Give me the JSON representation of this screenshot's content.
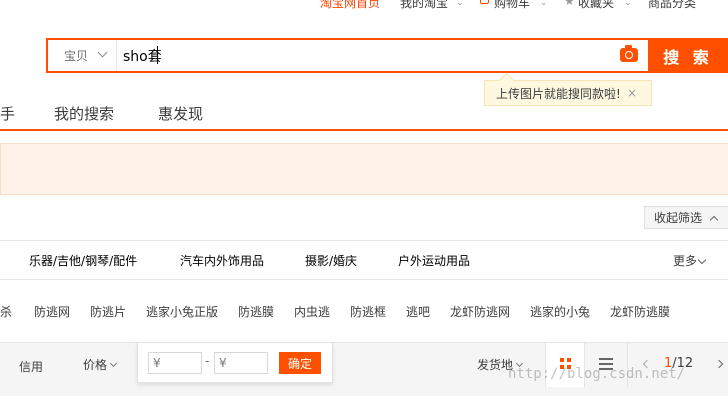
{
  "topbar": {
    "items": [
      "淘宝网首页",
      "我的淘宝",
      "购物车",
      "收藏夹",
      "商品分类"
    ]
  },
  "search": {
    "scope": "宝贝",
    "query": "sho套",
    "button": "搜 索",
    "tooltip": "上传图片就能搜同款啦!",
    "tooltip_close": "×"
  },
  "nav": {
    "tabs": [
      "手",
      "我的搜索",
      "惠发现"
    ]
  },
  "filters": {
    "collapse": "收起筛选"
  },
  "categories": {
    "items": [
      "乐器/吉他/钢琴/配件",
      "汽车内外饰用品",
      "摄影/婚庆",
      "户外运动用品"
    ],
    "more": "更多"
  },
  "related": {
    "words": [
      "杀",
      "防逃网",
      "防逃片",
      "逃家小兔正版",
      "防逃膜",
      "内虫逃",
      "防逃框",
      "逃吧",
      "龙虾防逃网",
      "逃家的小兔",
      "龙虾防逃膜"
    ]
  },
  "sortbar": {
    "credit": "信用",
    "price": "价格",
    "price_from_placeholder": "¥",
    "price_to_placeholder": "¥",
    "dash": "-",
    "confirm": "确定",
    "ship_from": "发货地",
    "page_current": "1",
    "page_total": "/12"
  },
  "watermark": "http://blog.csdn.net/",
  "colors": {
    "accent": "#ff5000",
    "notice_bg": "#fff2e8",
    "tooltip_bg": "#fff8e1"
  }
}
